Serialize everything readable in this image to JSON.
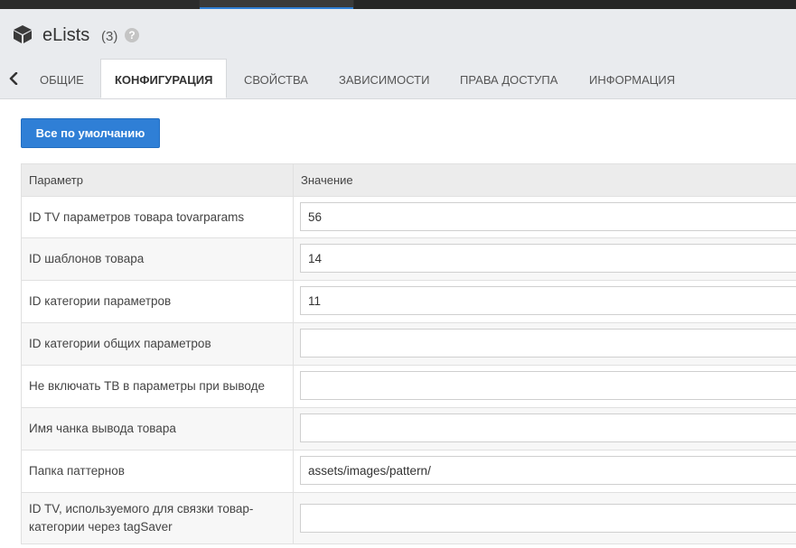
{
  "app": {
    "title": "eLists",
    "count": "(3)",
    "help_glyph": "?"
  },
  "tabs": [
    {
      "label": "ОБЩИЕ"
    },
    {
      "label": "КОНФИГУРАЦИЯ",
      "active": true
    },
    {
      "label": "СВОЙСТВА"
    },
    {
      "label": "ЗАВИСИМОСТИ"
    },
    {
      "label": "ПРАВА ДОСТУПА"
    },
    {
      "label": "ИНФОРМАЦИЯ"
    }
  ],
  "toolbar": {
    "default_label": "Все по умолчанию"
  },
  "grid": {
    "col_param": "Параметр",
    "col_value": "Значение",
    "rows": [
      {
        "label": "ID TV параметров товара tovarparams",
        "value": "56"
      },
      {
        "label": "ID шаблонов товара",
        "value": "14"
      },
      {
        "label": "ID категории параметров",
        "value": "11"
      },
      {
        "label": "ID категории общих параметров",
        "value": ""
      },
      {
        "label": "Не включать ТВ в параметры при выводе",
        "value": ""
      },
      {
        "label": "Имя чанка вывода товара",
        "value": ""
      },
      {
        "label": "Папка паттернов",
        "value": "assets/images/pattern/"
      },
      {
        "label": "ID TV, используемого для связки товар-категории через tagSaver",
        "value": ""
      }
    ]
  },
  "colors": {
    "accent": "#2f7fd6",
    "header_bg": "#e9ebee",
    "table_header_bg": "#ececec"
  },
  "icons": {
    "app": "cube-icon",
    "help": "help-icon",
    "back": "chevron-left-icon"
  }
}
